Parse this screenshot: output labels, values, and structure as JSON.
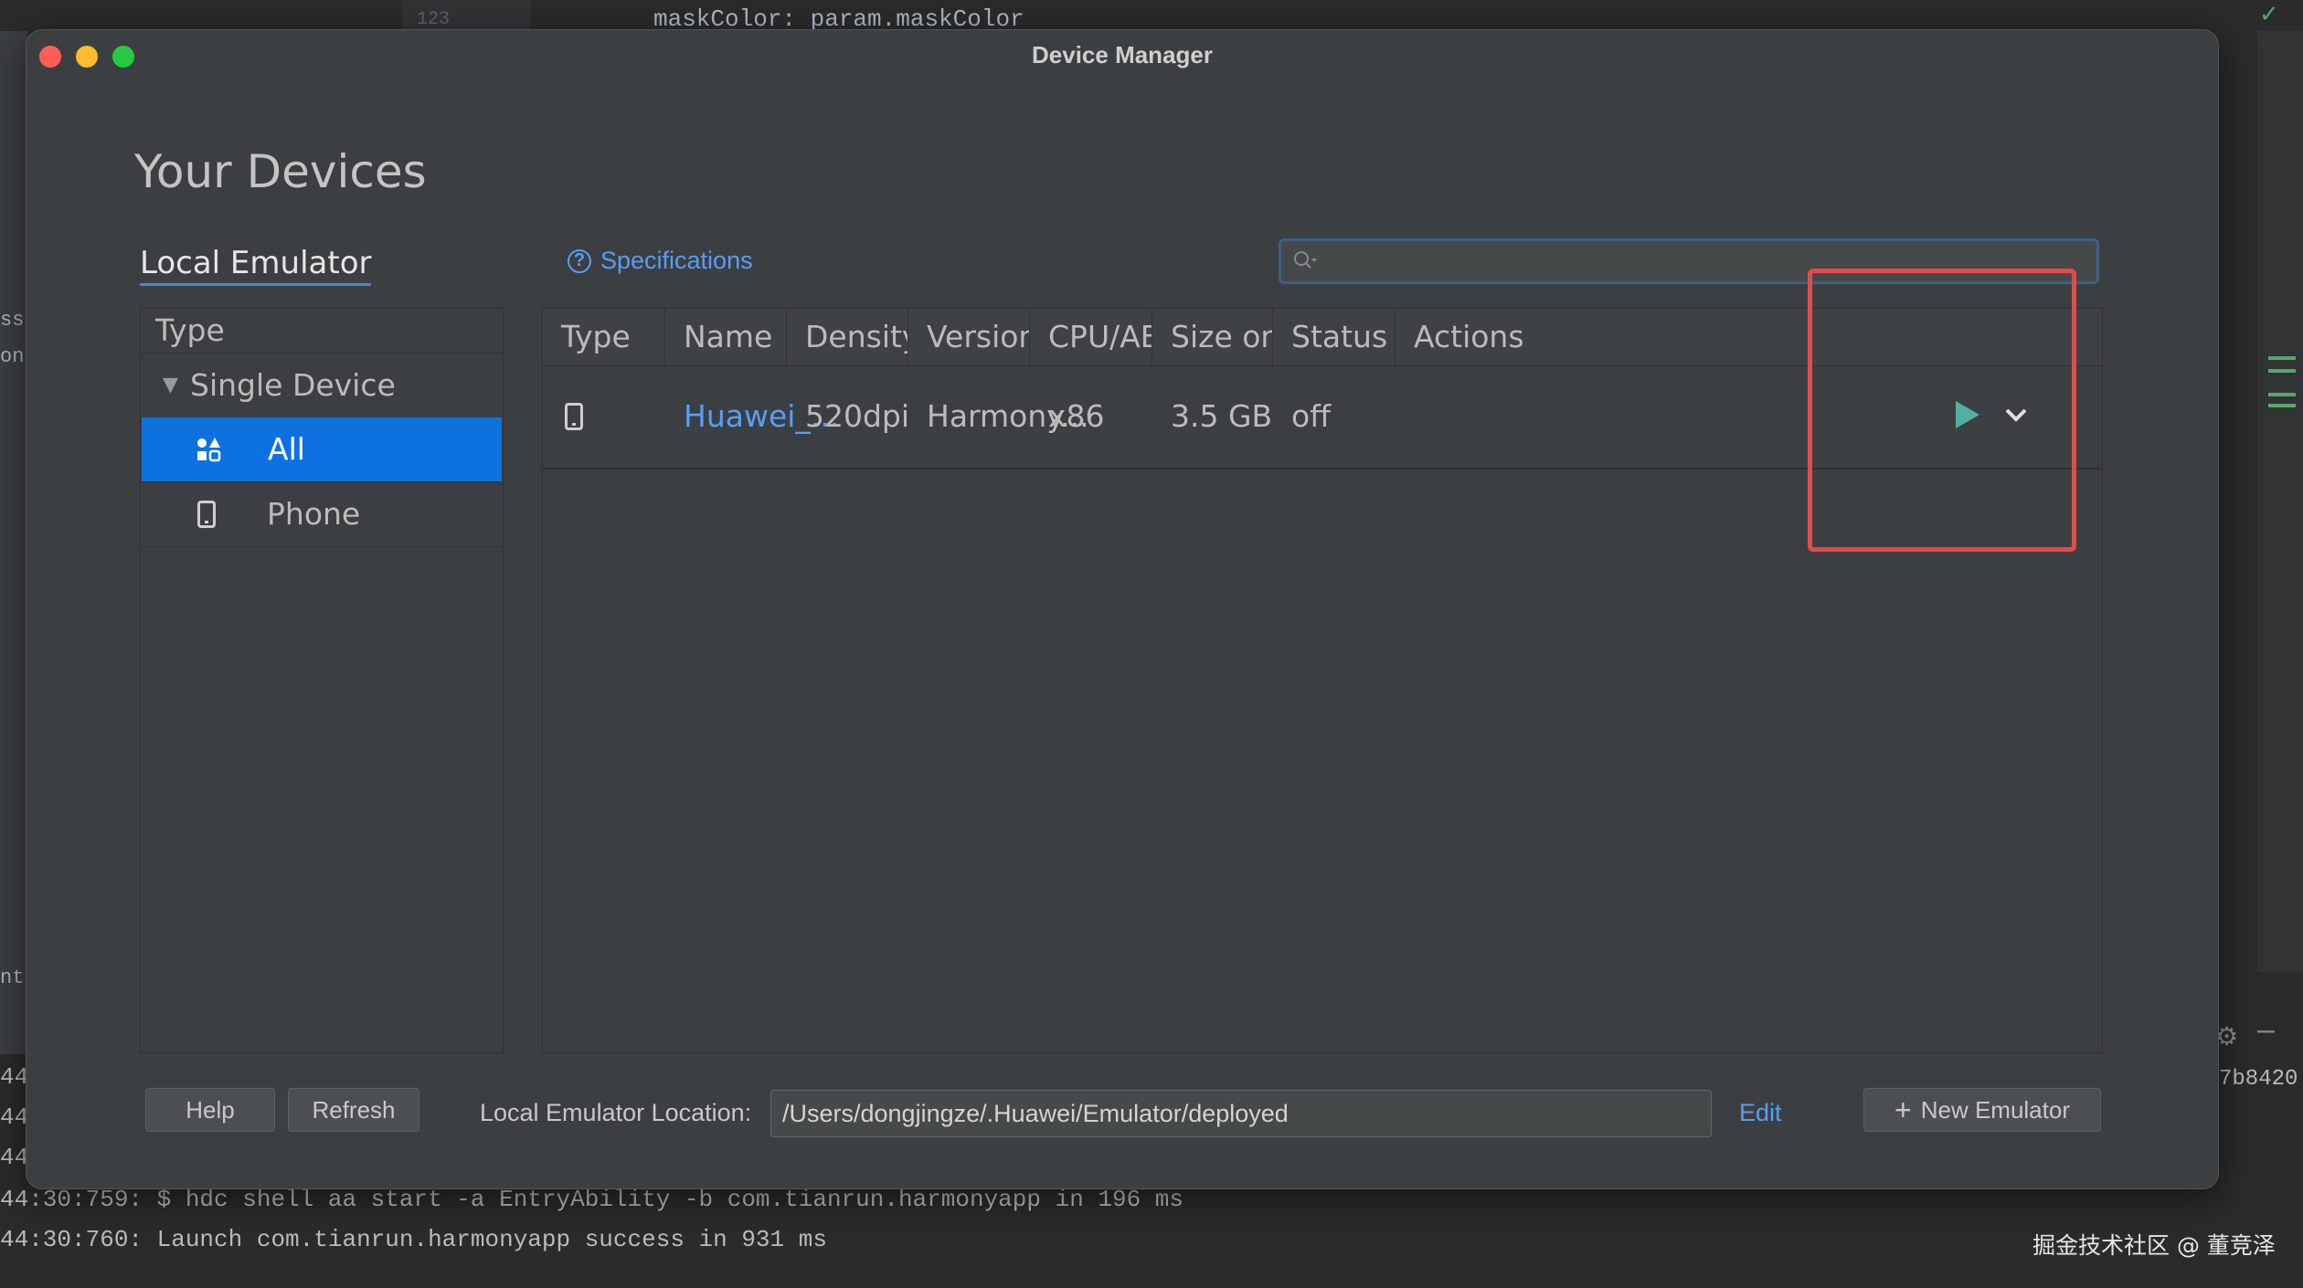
{
  "background": {
    "code_line_number": "123",
    "code_text": "maskColor: param.maskColor",
    "side_fragments": [
      "ss",
      "on",
      "ntr"
    ],
    "console_lines": [
      "44:30:759: $ hdc shell aa start -a EntryAbility -b com.tianrun.harmonyapp in 196 ms",
      "44:30:760: Launch com.tianrun.harmonyapp success in 931 ms"
    ],
    "console_edge": [
      "44",
      "44",
      "44"
    ],
    "console_right_text": "7b8420",
    "watermark": "掘金技术社区 @ 董竞泽"
  },
  "dialog": {
    "title": "Device Manager",
    "heading": "Your Devices",
    "tab": "Local Emulator",
    "specifications": "Specifications",
    "search_placeholder": ""
  },
  "left_panel": {
    "header": "Type",
    "group": "Single Device",
    "items": [
      {
        "label": "All",
        "icon": "all-devices-icon"
      },
      {
        "label": "Phone",
        "icon": "phone-icon"
      }
    ]
  },
  "table": {
    "columns": [
      "Type",
      "Name",
      "Density",
      "Version",
      "CPU/ABI",
      "Size on ...",
      "Status",
      "Actions"
    ],
    "rows": [
      {
        "type_icon": "phone-icon",
        "name": "Huawei_...",
        "density": "520dpi",
        "version": "Harmony...",
        "cpu": "x86",
        "size": "3.5 GB",
        "status": "off"
      }
    ]
  },
  "footer": {
    "help": "Help",
    "refresh": "Refresh",
    "location_label": "Local Emulator Location:",
    "location_value": "/Users/dongjingze/.Huawei/Emulator/deployed",
    "edit": "Edit",
    "new_emulator": "New Emulator"
  },
  "colors": {
    "accent": "#0d72e0",
    "link": "#589df6",
    "play": "#4fb0a3",
    "highlight": "#e34b4b"
  }
}
